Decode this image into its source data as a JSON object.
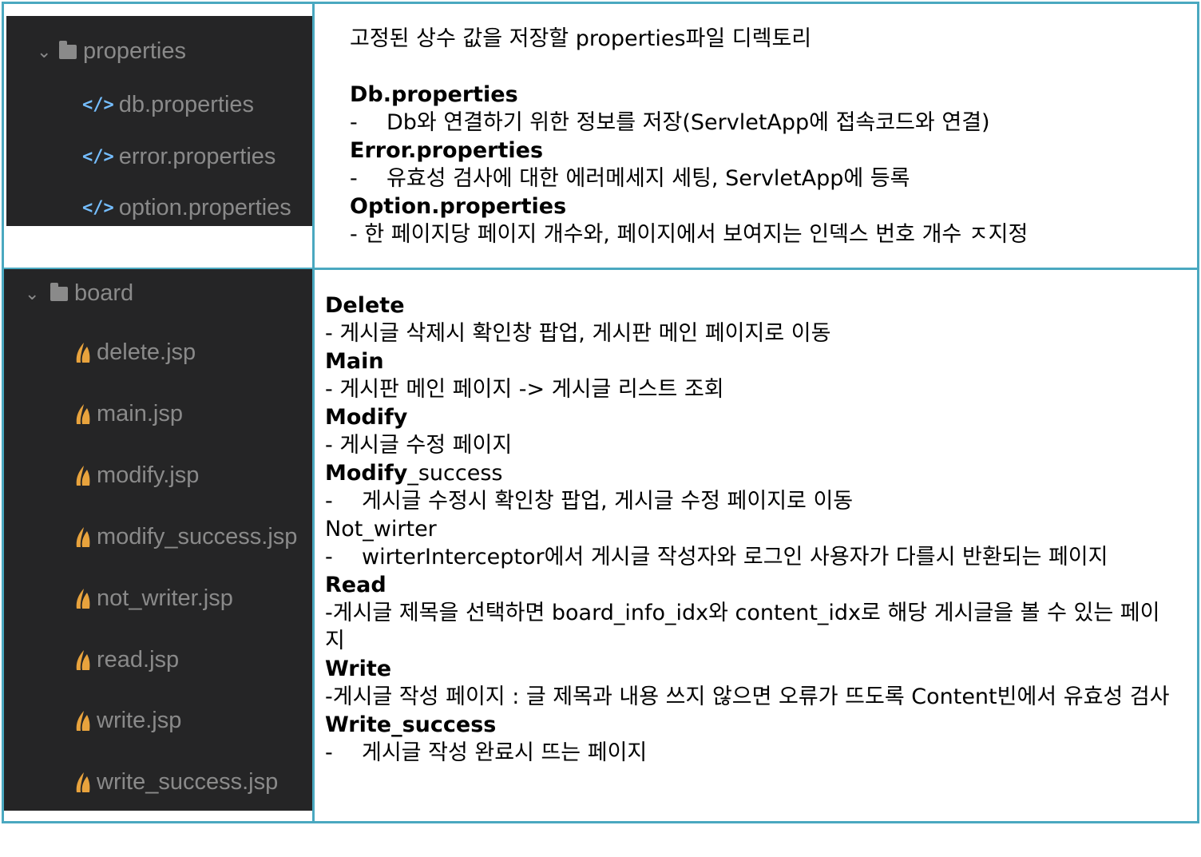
{
  "tree_top": {
    "folder": "properties",
    "files": [
      "db.properties",
      "error.properties",
      "option.properties"
    ]
  },
  "tree_bottom": {
    "folder": "board",
    "files": [
      "delete.jsp",
      "main.jsp",
      "modify.jsp",
      "modify_success.jsp",
      "not_writer.jsp",
      "read.jsp",
      "write.jsp",
      "write_success.jsp"
    ]
  },
  "section1": {
    "intro": "고정된 상수 값을 저장할 properties파일 디렉토리",
    "db_title": "Db.properties",
    "db_desc": "Db와 연결하기 위한 정보를 저장(ServletApp에 접속코드와 연결)",
    "error_title": "Error.properties",
    "error_desc": "유효성 검사에 대한 에러메세지 세팅, ServletApp에 등록",
    "option_title": "Option.properties",
    "option_desc": "- 한 페이지당 페이지 개수와, 페이지에서 보여지는 인덱스 번호 개수 ㅈ지정"
  },
  "section2": {
    "delete_title": "Delete",
    "delete_desc": "- 게시글 삭제시 확인창 팝업, 게시판 메인 페이지로 이동",
    "main_title": "Main",
    "main_desc": "- 게시판 메인 페이지 -> 게시글 리스트 조회",
    "modify_title": "Modify",
    "modify_desc": "- 게시글 수정 페이지",
    "modify_success_title_bold": "Modify",
    "modify_success_title_rest": "_success",
    "modify_success_desc": "게시글 수정시 확인창 팝업, 게시글 수정 페이지로 이동",
    "not_writer_title": "Not_wirter",
    "not_writer_desc": "wirterInterceptor에서 게시글 작성자와 로그인 사용자가 다를시 반환되는 페이지",
    "read_title": "Read",
    "read_desc": "-게시글 제목을 선택하면 board_info_idx와 content_idx로 해당 게시글을 볼 수 있는 페이지",
    "write_title": "Write",
    "write_desc": "-게시글 작성 페이지 : 글 제목과 내용 쓰지 않으면 오류가 뜨도록 Content빈에서 유효성 검사",
    "write_success_title": "Write_success",
    "write_success_desc": "게시글 작성 완료시 뜨는 페이지",
    "dash": "-"
  }
}
